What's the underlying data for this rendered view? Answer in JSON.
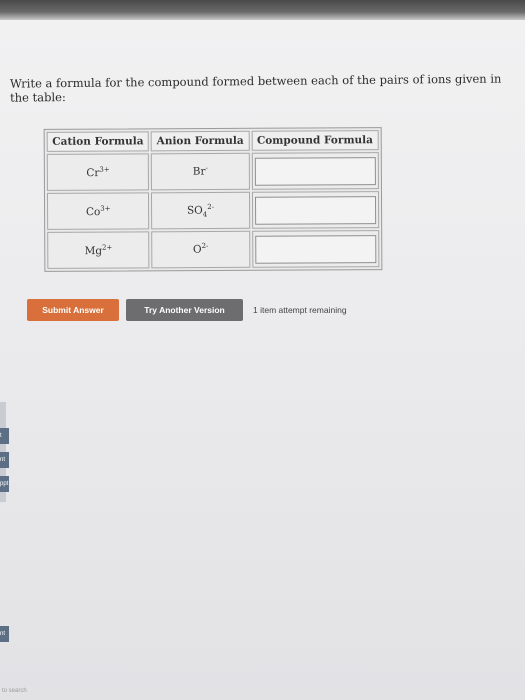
{
  "question": {
    "text": "Write a formula for the compound formed between each of the pairs of ions given in the table:"
  },
  "table": {
    "headers": [
      "Cation Formula",
      "Anion Formula",
      "Compound Formula"
    ],
    "rows": [
      {
        "cation_base": "Cr",
        "cation_sup": "3+",
        "anion_base": "Br",
        "anion_sub": "",
        "anion_sup": "-",
        "compound_value": ""
      },
      {
        "cation_base": "Co",
        "cation_sup": "3+",
        "anion_base": "SO",
        "anion_sub": "4",
        "anion_sup": "2-",
        "compound_value": ""
      },
      {
        "cation_base": "Mg",
        "cation_sup": "2+",
        "anion_base": "O",
        "anion_sub": "",
        "anion_sup": "2-",
        "compound_value": ""
      }
    ]
  },
  "buttons": {
    "submit": "Submit Answer",
    "try_another": "Try Another Version"
  },
  "attempts": "1 item attempt remaining",
  "sidebar_tabs": [
    "t",
    "nt",
    "ppt",
    "nt"
  ],
  "taskbar_text": "to search",
  "colors": {
    "submit": "#d96f3a",
    "try": "#6d6d70",
    "tab": "#5c6f84"
  }
}
